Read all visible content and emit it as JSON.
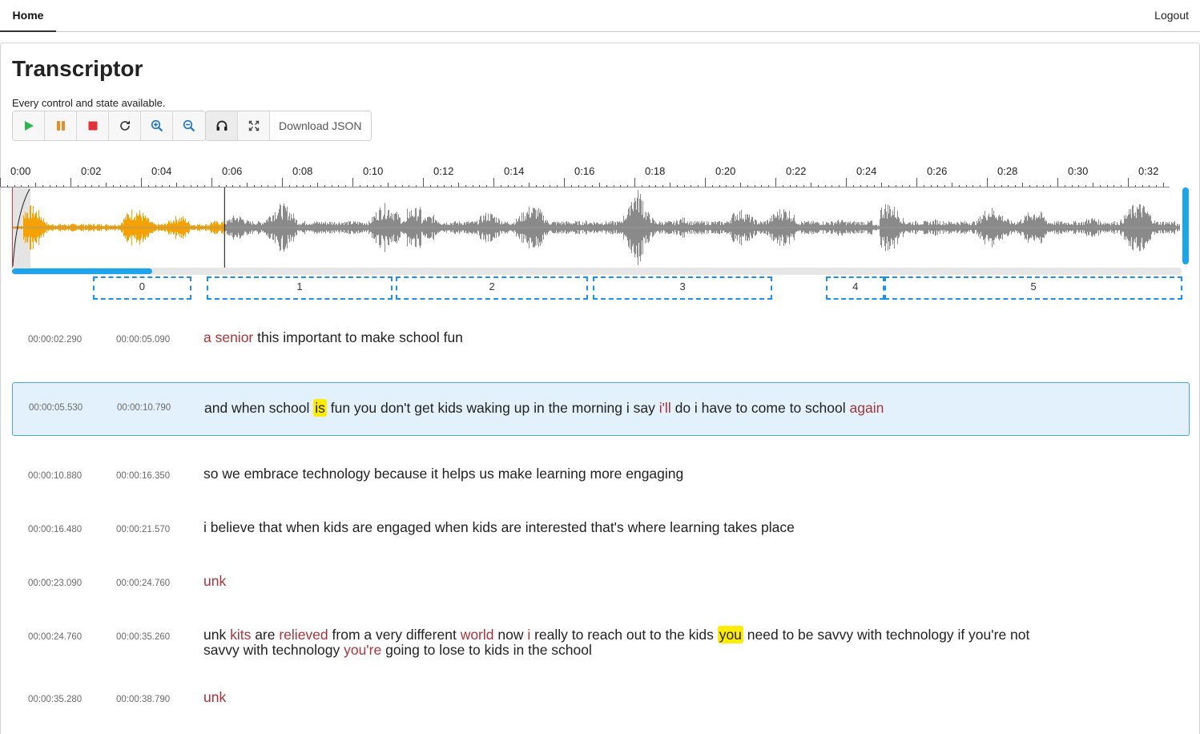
{
  "nav": {
    "home": "Home",
    "logout": "Logout"
  },
  "page": {
    "title": "Transcriptor",
    "subtitle": "Every control and state available."
  },
  "toolbar": {
    "play_icon": "play-icon",
    "pause_icon": "pause-icon",
    "stop_icon": "stop-icon",
    "replay_icon": "replay-icon",
    "zoom_in_icon": "zoom-in-icon",
    "zoom_out_icon": "zoom-out-icon",
    "headphones_icon": "headphones-icon",
    "fullscreen_icon": "fullscreen-icon",
    "download_label": "Download JSON"
  },
  "colors": {
    "played": "#f6a100",
    "unplayed": "#8a8a8a",
    "accent": "#1ea4ea",
    "error_word": "#a7343a",
    "highlight": "#ffec00"
  },
  "timeline": {
    "labels": [
      "0:00",
      "0:02",
      "0:04",
      "0:06",
      "0:08",
      "0:10",
      "0:12",
      "0:14",
      "0:16",
      "0:18",
      "0:20",
      "0:22",
      "0:24",
      "0:26",
      "0:28",
      "0:30",
      "0:32"
    ],
    "duration_seconds": 33.2,
    "playhead_seconds": 6.03,
    "scroll_position": 0.12
  },
  "segments": [
    {
      "label": "0",
      "start": 2.29,
      "end": 5.09
    },
    {
      "label": "1",
      "start": 5.53,
      "end": 10.79
    },
    {
      "label": "2",
      "start": 10.88,
      "end": 16.35
    },
    {
      "label": "3",
      "start": 16.48,
      "end": 21.57
    },
    {
      "label": "4",
      "start": 23.09,
      "end": 24.76
    },
    {
      "label": "5",
      "start": 24.76,
      "end": 33.2
    }
  ],
  "transcript": [
    {
      "start": "00:00:02.290",
      "end": "00:00:05.090",
      "active": false,
      "words": [
        {
          "t": "a senior",
          "s": "red"
        },
        {
          "t": " this important to make school fun",
          "s": ""
        }
      ]
    },
    {
      "start": "00:00:05.530",
      "end": "00:00:10.790",
      "active": true,
      "words": [
        {
          "t": "and when school ",
          "s": ""
        },
        {
          "t": "is",
          "s": "hl"
        },
        {
          "t": " fun you don't get kids waking up in the morning i say ",
          "s": ""
        },
        {
          "t": "i'll",
          "s": "red"
        },
        {
          "t": " do i have to come to school ",
          "s": ""
        },
        {
          "t": "again",
          "s": "red"
        }
      ]
    },
    {
      "start": "00:00:10.880",
      "end": "00:00:16.350",
      "active": false,
      "words": [
        {
          "t": "so we embrace technology because it helps us make learning more engaging",
          "s": ""
        }
      ]
    },
    {
      "start": "00:00:16.480",
      "end": "00:00:21.570",
      "active": false,
      "words": [
        {
          "t": "i believe that when kids are engaged when kids are interested that's where learning takes place",
          "s": ""
        }
      ]
    },
    {
      "start": "00:00:23.090",
      "end": "00:00:24.760",
      "active": false,
      "words": [
        {
          "t": "unk",
          "s": "red"
        }
      ]
    },
    {
      "start": "00:00:24.760",
      "end": "00:00:35.260",
      "active": false,
      "words": [
        {
          "t": "unk ",
          "s": ""
        },
        {
          "t": "kits",
          "s": "red"
        },
        {
          "t": " are ",
          "s": ""
        },
        {
          "t": "relieved",
          "s": "red"
        },
        {
          "t": " from a very different ",
          "s": ""
        },
        {
          "t": "world",
          "s": "red"
        },
        {
          "t": " now ",
          "s": ""
        },
        {
          "t": "i",
          "s": "red"
        },
        {
          "t": " really to reach out to the kids ",
          "s": ""
        },
        {
          "t": "you",
          "s": "hl"
        },
        {
          "t": " need to be savvy with technology if you're not savvy with technology ",
          "s": ""
        },
        {
          "t": "you're",
          "s": "red"
        },
        {
          "t": " going to lose to kids in the school",
          "s": ""
        }
      ]
    },
    {
      "start": "00:00:35.280",
      "end": "00:00:38.790",
      "active": false,
      "words": [
        {
          "t": "unk",
          "s": "red"
        }
      ]
    }
  ]
}
